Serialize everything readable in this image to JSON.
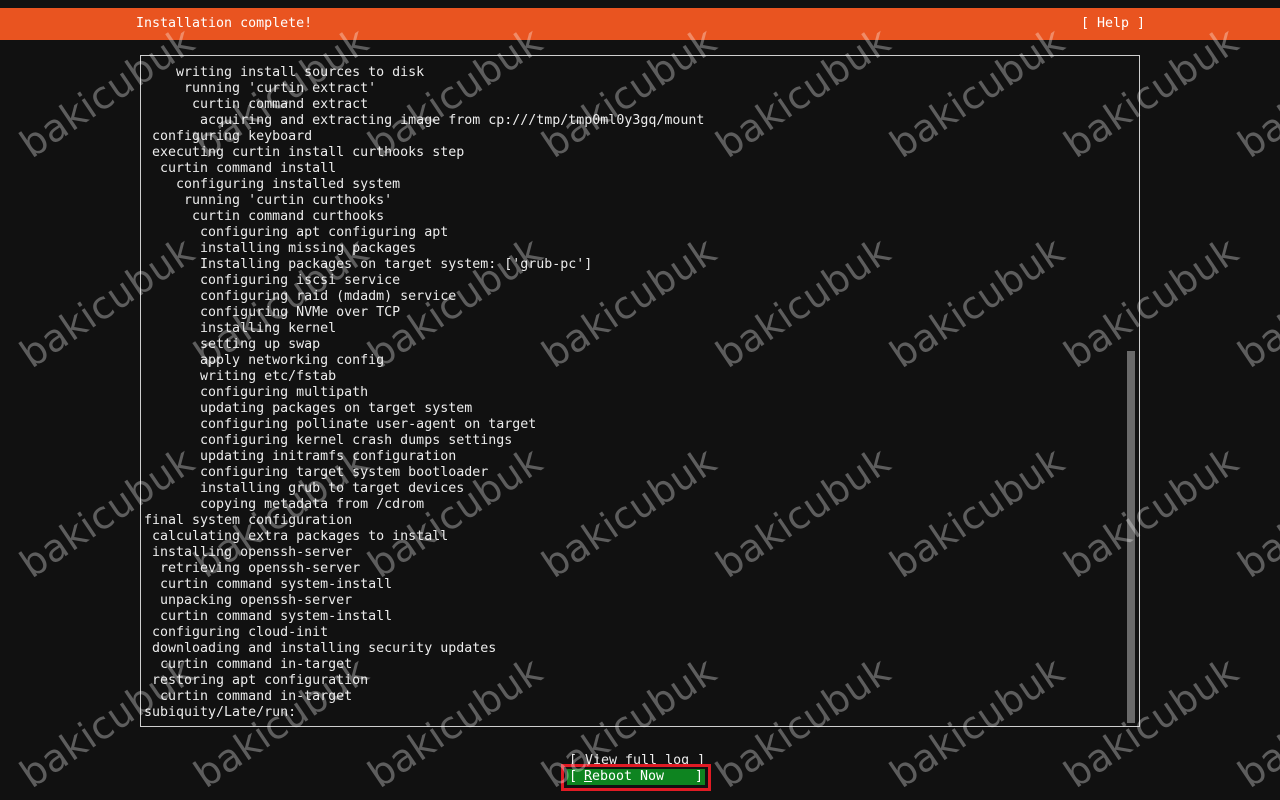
{
  "header": {
    "title": "Installation complete!",
    "help_label": "[ Help ]",
    "bar_color": "#e95420"
  },
  "log": {
    "lines": [
      "    writing install sources to disk",
      "     running 'curtin extract'",
      "      curtin command extract",
      "       acquiring and extracting image from cp:///tmp/tmp0ml0y3gq/mount",
      " configuring keyboard",
      " executing curtin install curthooks step",
      "  curtin command install",
      "    configuring installed system",
      "     running 'curtin curthooks'",
      "      curtin command curthooks",
      "       configuring apt configuring apt",
      "       installing missing packages",
      "       Installing packages on target system: ['grub-pc']",
      "       configuring iscsi service",
      "       configuring raid (mdadm) service",
      "       configuring NVMe over TCP",
      "       installing kernel",
      "       setting up swap",
      "       apply networking config",
      "       writing etc/fstab",
      "       configuring multipath",
      "       updating packages on target system",
      "       configuring pollinate user-agent on target",
      "       configuring kernel crash dumps settings",
      "       updating initramfs configuration",
      "       configuring target system bootloader",
      "       installing grub to target devices",
      "       copying metadata from /cdrom",
      "final system configuration",
      " calculating extra packages to install",
      " installing openssh-server",
      "  retrieving openssh-server",
      "  curtin command system-install",
      "  unpacking openssh-server",
      "  curtin command system-install",
      " configuring cloud-init",
      " downloading and installing security updates",
      "  curtin command in-target",
      " restoring apt configuration",
      "  curtin command in-target",
      "subiquity/Late/run:"
    ]
  },
  "buttons": {
    "view_log": "[ View full log ]",
    "reboot_open": "[",
    "reboot_hotkey": "R",
    "reboot_rest": "eboot Now",
    "reboot_close": "]",
    "reboot_color": "#0e8420",
    "highlight_color": "#e01b24"
  },
  "watermark": {
    "text": "bakicubuk"
  }
}
